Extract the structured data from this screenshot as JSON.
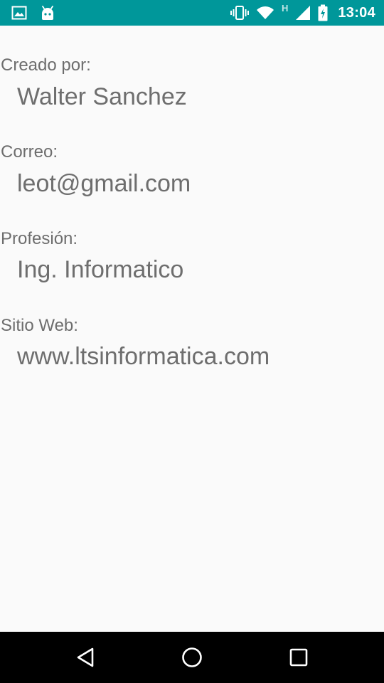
{
  "status_bar": {
    "time": "13:04",
    "network_label": "H",
    "icons": [
      "image-icon",
      "android-icon",
      "vibrate-icon",
      "wifi-icon",
      "cell-signal-icon",
      "battery-charging-icon"
    ],
    "background_color": "#00979a"
  },
  "profile": {
    "created_by_label": "Creado por:",
    "created_by_value": "Walter Sanchez",
    "email_label": "Correo:",
    "email_value": "leot@gmail.com",
    "profession_label": "Profesión:",
    "profession_value": "Ing. Informatico",
    "website_label": "Sitio Web:",
    "website_value": "www.ltsinformatica.com"
  },
  "nav_bar": {
    "buttons": [
      "back-icon",
      "home-icon",
      "recents-icon"
    ]
  }
}
